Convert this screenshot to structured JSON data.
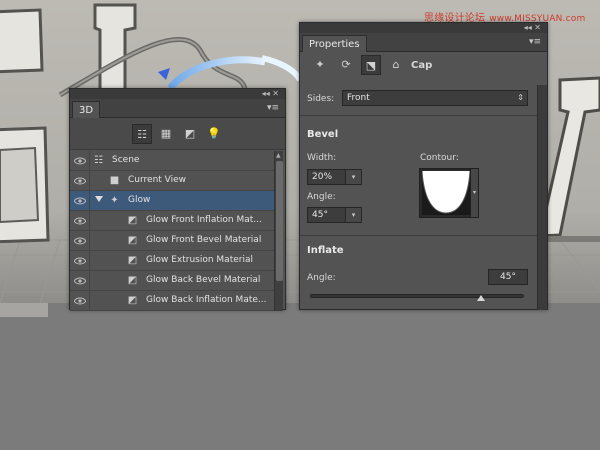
{
  "watermark": {
    "text": "思缘设计论坛",
    "url": "www.MISSYUAN.com"
  },
  "panel_3d": {
    "tab_label": "3D",
    "top_controls": "◂◂ ✕",
    "menu_glyph": "▾≡",
    "toolbar": [
      {
        "name": "scene-filter-icon",
        "glyph": "☷",
        "active": true
      },
      {
        "name": "mesh-filter-icon",
        "glyph": "▦",
        "active": false
      },
      {
        "name": "material-filter-icon",
        "glyph": "◩",
        "active": false
      },
      {
        "name": "light-filter-icon",
        "glyph": "💡",
        "active": false
      }
    ],
    "layers": [
      {
        "label": "Scene",
        "icon": "scene-icon",
        "glyph": "☷",
        "indent": 0,
        "eye": true,
        "selected": false,
        "arrow": false
      },
      {
        "label": "Current View",
        "icon": "camera-icon",
        "glyph": "■",
        "indent": 1,
        "eye": true,
        "selected": false,
        "arrow": false
      },
      {
        "label": "Glow",
        "icon": "mesh-icon",
        "glyph": "✦",
        "indent": 1,
        "eye": true,
        "selected": true,
        "arrow": true
      },
      {
        "label": "Glow Front Inflation Mat...",
        "icon": "material-icon",
        "glyph": "◩",
        "indent": 2,
        "eye": true,
        "selected": false,
        "arrow": false
      },
      {
        "label": "Glow Front Bevel Material",
        "icon": "material-icon",
        "glyph": "◩",
        "indent": 2,
        "eye": true,
        "selected": false,
        "arrow": false
      },
      {
        "label": "Glow Extrusion Material",
        "icon": "material-icon",
        "glyph": "◩",
        "indent": 2,
        "eye": true,
        "selected": false,
        "arrow": false
      },
      {
        "label": "Glow Back Bevel Material",
        "icon": "material-icon",
        "glyph": "◩",
        "indent": 2,
        "eye": true,
        "selected": false,
        "arrow": false
      },
      {
        "label": "Glow Back Inflation Mate...",
        "icon": "material-icon",
        "glyph": "◩",
        "indent": 2,
        "eye": true,
        "selected": false,
        "arrow": false
      }
    ]
  },
  "properties": {
    "tab_label": "Properties",
    "top_controls": "◂◂ ✕",
    "menu_glyph": "▾≡",
    "toolbar": [
      {
        "name": "mesh-props-icon",
        "glyph": "✦",
        "active": false
      },
      {
        "name": "deform-props-icon",
        "glyph": "⟳",
        "active": false
      },
      {
        "name": "cap-props-icon",
        "glyph": "⬔",
        "active": true
      },
      {
        "name": "coordinates-props-icon",
        "glyph": "⌂",
        "active": false
      }
    ],
    "mode_label": "Cap",
    "sides": {
      "label": "Sides:",
      "value": "Front"
    },
    "bevel": {
      "title": "Bevel",
      "width_label": "Width:",
      "width_value": "20%",
      "contour_label": "Contour:",
      "angle_label": "Angle:",
      "angle_value": "45°"
    },
    "inflate": {
      "title": "Inflate",
      "angle_label": "Angle:",
      "angle_value": "45°",
      "slider_position": 0.8
    }
  },
  "colors": {
    "panel_bg": "#535353",
    "selected_row": "#3e5a7a",
    "canvas_bg": "#b9b7b1",
    "watermark": "#cc3a2a"
  }
}
